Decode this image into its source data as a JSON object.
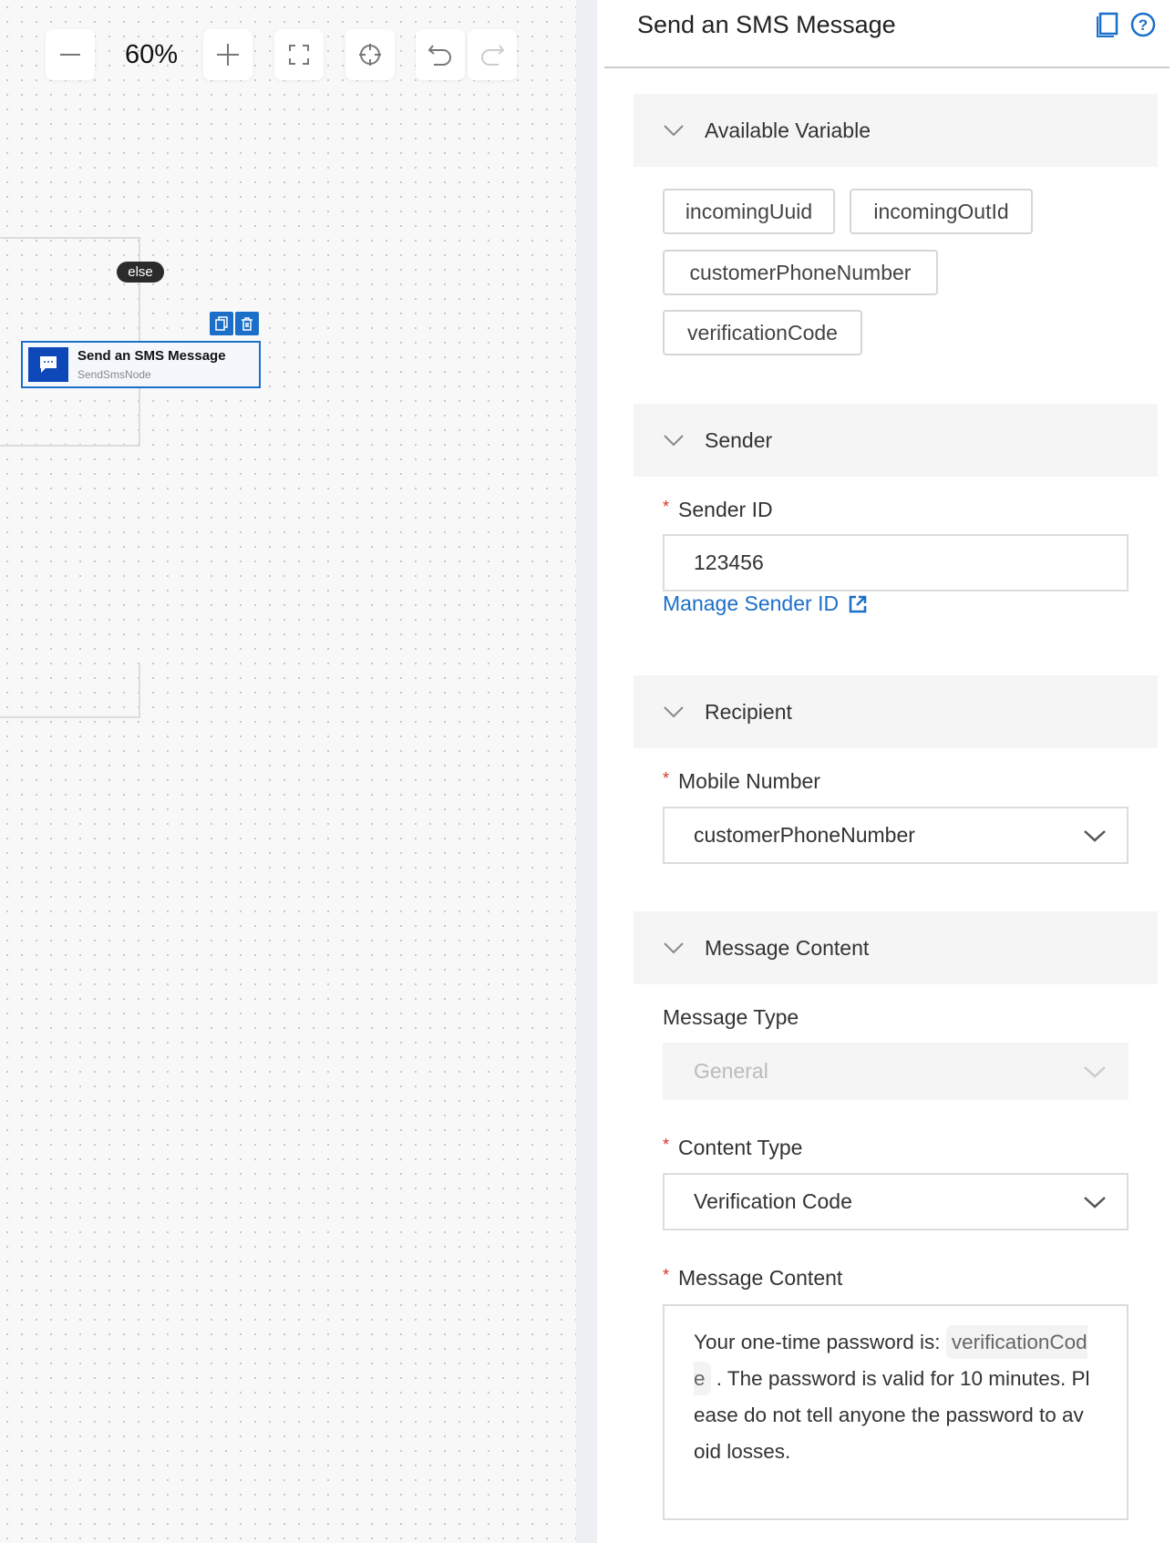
{
  "toolbar": {
    "zoom": "60%"
  },
  "canvas": {
    "edge_label": "else",
    "node": {
      "title": "Send an SMS Message",
      "subtitle": "SendSmsNode"
    }
  },
  "panel": {
    "title": "Send an SMS Message",
    "sections": {
      "variables": "Available Variable",
      "sender": "Sender",
      "recipient": "Recipient",
      "content": "Message Content"
    },
    "variables": [
      "incomingUuid",
      "incomingOutId",
      "customerPhoneNumber",
      "verificationCode"
    ],
    "sender": {
      "label": "Sender ID",
      "value": "123456",
      "link": "Manage Sender ID"
    },
    "recipient": {
      "label": "Mobile Number",
      "value": "customerPhoneNumber"
    },
    "content": {
      "message_type_label": "Message Type",
      "message_type_value": "General",
      "content_type_label": "Content Type",
      "content_type_value": "Verification Code",
      "message_label": "Message Content",
      "message_before": "Your one-time password is: ",
      "message_variable": "verificationCode",
      "message_after": " . The password is valid for 10 minutes. Please do not tell anyone the password to avoid losses."
    },
    "required_mark": "*"
  },
  "colors": {
    "accent": "#1b6fc9",
    "required": "#d93026"
  }
}
